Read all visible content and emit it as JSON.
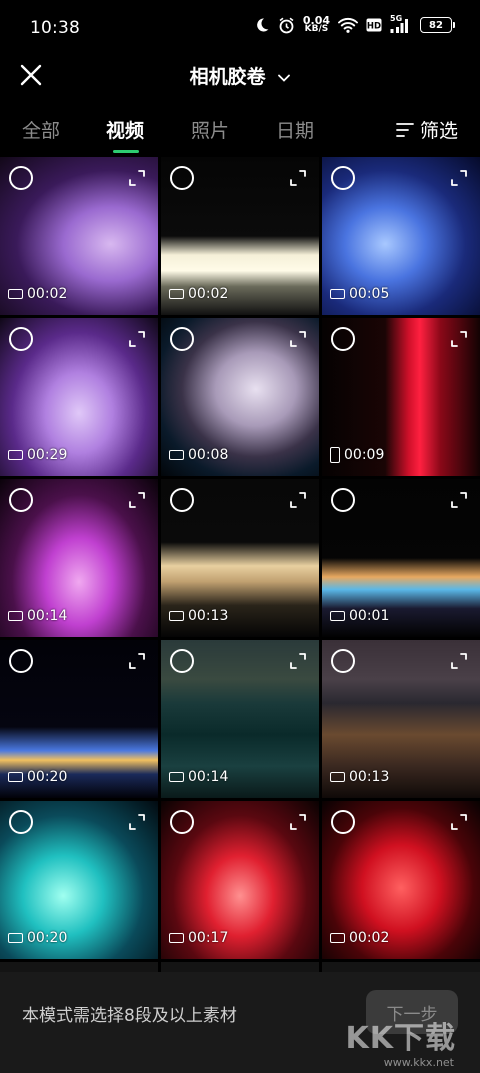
{
  "status_bar": {
    "time": "10:38",
    "speed_value": "0.04",
    "speed_unit": "KB/S",
    "network": "5G",
    "battery": "82"
  },
  "header": {
    "title": "相机胶卷"
  },
  "tabs": [
    {
      "label": "全部",
      "active": false
    },
    {
      "label": "视频",
      "active": true
    },
    {
      "label": "照片",
      "active": false
    },
    {
      "label": "日期",
      "active": false
    }
  ],
  "filter_label": "筛选",
  "accent_color": "#2ecc71",
  "videos": [
    {
      "duration": "00:02",
      "orientation": "landscape",
      "scene": "purple-mist"
    },
    {
      "duration": "00:02",
      "orientation": "landscape",
      "scene": "white-fountain"
    },
    {
      "duration": "00:05",
      "orientation": "landscape",
      "scene": "blue-arc"
    },
    {
      "duration": "00:29",
      "orientation": "landscape",
      "scene": "violet-spray"
    },
    {
      "duration": "00:08",
      "orientation": "landscape",
      "scene": "white-arc"
    },
    {
      "duration": "00:09",
      "orientation": "portrait",
      "scene": "red-column"
    },
    {
      "duration": "00:14",
      "orientation": "landscape",
      "scene": "magenta-jets"
    },
    {
      "duration": "00:13",
      "orientation": "landscape",
      "scene": "golden-arches"
    },
    {
      "duration": "00:01",
      "orientation": "landscape",
      "scene": "rainbow-line"
    },
    {
      "duration": "00:20",
      "orientation": "landscape",
      "scene": "night-lights"
    },
    {
      "duration": "00:14",
      "orientation": "landscape",
      "scene": "crowd-city"
    },
    {
      "duration": "00:13",
      "orientation": "landscape",
      "scene": "crowd-lake"
    },
    {
      "duration": "00:20",
      "orientation": "landscape",
      "scene": "cyan-jets"
    },
    {
      "duration": "00:17",
      "orientation": "landscape",
      "scene": "red-dome"
    },
    {
      "duration": "00:02",
      "orientation": "landscape",
      "scene": "red-lasers"
    }
  ],
  "bottom_bar": {
    "hint": "本模式需选择8段及以上素材",
    "next_label": "下一步"
  },
  "watermark": {
    "logo": "KK下载",
    "url": "www.kkx.net"
  }
}
